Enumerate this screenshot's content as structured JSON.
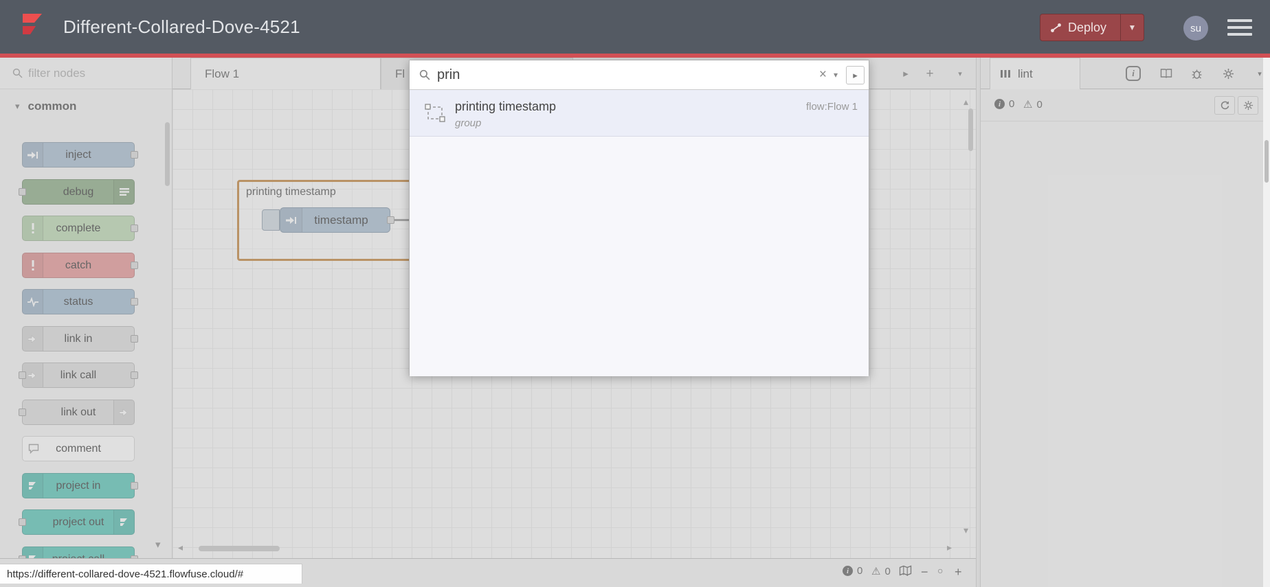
{
  "header": {
    "title": "Different-Collared-Dove-4521",
    "deploy_label": "Deploy",
    "avatar_text": "su",
    "deploy_color": "#9a4649",
    "accent_line_color": "#d25055"
  },
  "palette": {
    "filter_placeholder": "filter nodes",
    "category_label": "common",
    "nodes": [
      {
        "label": "inject",
        "color": "#a6bbcf"
      },
      {
        "label": "debug",
        "color": "#87a980"
      },
      {
        "label": "complete",
        "color": "#b9d7b0"
      },
      {
        "label": "catch",
        "color": "#e49191"
      },
      {
        "label": "status",
        "color": "#9fb9cf"
      },
      {
        "label": "link in",
        "color": "#dddddd"
      },
      {
        "label": "link call",
        "color": "#dddddd"
      },
      {
        "label": "link out",
        "color": "#dddddd"
      },
      {
        "label": "comment",
        "color": "#ffffff"
      },
      {
        "label": "project in",
        "color": "#50c3b5"
      },
      {
        "label": "project out",
        "color": "#50c3b5"
      },
      {
        "label": "project call",
        "color": "#50c3b5"
      }
    ]
  },
  "tabs": {
    "active_label": "Flow 1",
    "partial_label": "Fl",
    "modified_dot_color": "#3da1e0",
    "scroll_next": "▸",
    "add": "+",
    "list_caret": "▾"
  },
  "canvas": {
    "group_label": "printing timestamp",
    "group_border_color": "#bf7e33",
    "node_label": "timestamp",
    "node_color": "#a6bbcf"
  },
  "search": {
    "value": "prin",
    "clear_glyph": "×",
    "caret_glyph": "▾",
    "aux_glyph": "▸",
    "result": {
      "title": "printing timestamp",
      "type": "group",
      "flow": "flow:Flow 1"
    }
  },
  "sidebar": {
    "tab_label": "lint",
    "info_glyph": "i",
    "error_count": "0",
    "warning_glyph": "⚠",
    "warning_count": "0",
    "hidden_tabs_caret": "▾"
  },
  "footer": {
    "info_glyph": "i",
    "info_count": "0",
    "warning_glyph": "⚠",
    "warning_count": "0",
    "zoom_out": "−",
    "zoom_reset": "○",
    "zoom_in": "+"
  },
  "scroll": {
    "up": "▴",
    "down": "▾",
    "left": "◂",
    "right": "▸"
  },
  "browser": {
    "status_url": "https://different-collared-dove-4521.flowfuse.cloud/#"
  }
}
